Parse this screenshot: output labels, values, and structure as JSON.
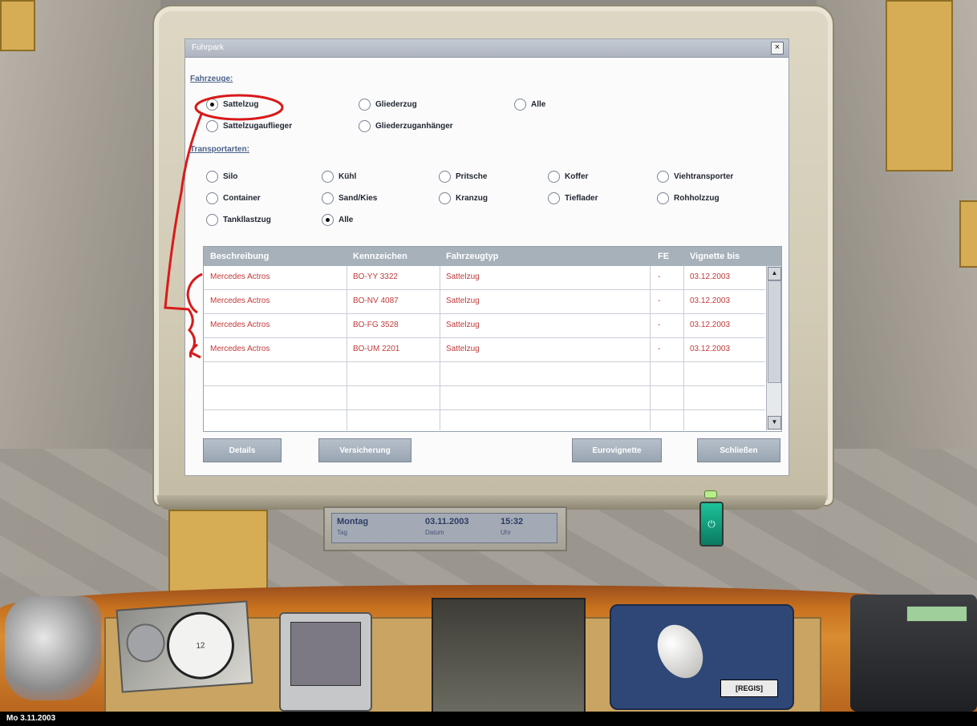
{
  "dialog": {
    "title": "Fuhrpark",
    "close": "×",
    "vehicles_label": "Fahrzeuge:",
    "vehicle_options": [
      "Sattelzug",
      "Gliederzug",
      "Alle",
      "Sattelzugauflieger",
      "Gliederzuganhänger"
    ],
    "transport_label": "Transportarten:",
    "transport_options": [
      "Silo",
      "Kühl",
      "Pritsche",
      "Koffer",
      "Viehtransporter",
      "Container",
      "Sand/Kies",
      "Kranzug",
      "Tieflader",
      "Rohholzzug",
      "Tankllastzug",
      "Alle"
    ],
    "table": {
      "headers": [
        "Beschreibung",
        "Kennzeichen",
        "Fahrzeugtyp",
        "FE",
        "Vignette bis"
      ],
      "rows": [
        [
          "Mercedes Actros",
          "BO-YY 3322",
          "Sattelzug",
          "-",
          "03.12.2003"
        ],
        [
          "Mercedes Actros",
          "BO-NV 4087",
          "Sattelzug",
          "-",
          "03.12.2003"
        ],
        [
          "Mercedes Actros",
          "BO-FG 3528",
          "Sattelzug",
          "-",
          "03.12.2003"
        ],
        [
          "Mercedes Actros",
          "BO-UM 2201",
          "Sattelzug",
          "-",
          "03.12.2003"
        ]
      ]
    },
    "buttons": [
      "Details",
      "Versicherung",
      "Eurovignette",
      "Schließen"
    ]
  },
  "lcd": {
    "day": "Montag",
    "day_label": "Tag",
    "date": "03.11.2003",
    "date_label": "Datum",
    "time": "15:32",
    "time_label": "Uhr"
  },
  "status_bar": "Mo 3.11.2003",
  "pad_logo": "[REGIS]",
  "colors": {
    "annotation": "#d81a1a",
    "accent": "#4c6389",
    "row_text": "#c13a3a"
  }
}
